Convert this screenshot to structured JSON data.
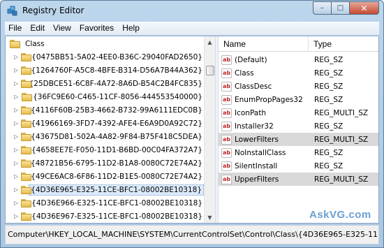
{
  "window": {
    "title": "Registry Editor"
  },
  "menu": [
    "File",
    "Edit",
    "View",
    "Favorites",
    "Help"
  ],
  "tree": {
    "root": "Class",
    "items": [
      "{0475BB51-5A02-4EE0-B36C-29040FAD2650}",
      "{1264760F-A5C8-4BFE-B314-D56A7B44A362}",
      "{25DBCE51-6C8F-4A72-8A6D-B54C2B4FC835}",
      "{36FC9E60-C465-11CF-8056-444553540000}",
      "{4116F60B-25B3-4662-B732-99A6111EDC0B}",
      "{41966169-3FD7-4392-AFE4-E6A9D0A92C72}",
      "{43675D81-502A-4A82-9F84-B75F418C5DEA}",
      "{4658EE7E-F050-11D1-B6BD-00C04FA372A7}",
      "{48721B56-6795-11D2-B1A8-0080C72E74A2}",
      "{49CE6AC8-6F86-11D2-B1E5-0080C72E74A2}",
      "{4D36E965-E325-11CE-BFC1-08002BE10318}",
      "{4D36E966-E325-11CE-BFC1-08002BE10318}",
      "{4D36E967-E325-11CE-BFC1-08002BE10318}"
    ],
    "selected_index": 10
  },
  "values_list": {
    "headers": {
      "name": "Name",
      "type": "Type"
    },
    "rows": [
      {
        "name": "(Default)",
        "type": "REG_SZ",
        "highlight": false
      },
      {
        "name": "Class",
        "type": "REG_SZ",
        "highlight": false
      },
      {
        "name": "ClassDesc",
        "type": "REG_SZ",
        "highlight": false
      },
      {
        "name": "EnumPropPages32",
        "type": "REG_SZ",
        "highlight": false
      },
      {
        "name": "IconPath",
        "type": "REG_MULTI_SZ",
        "highlight": false
      },
      {
        "name": "Installer32",
        "type": "REG_SZ",
        "highlight": false
      },
      {
        "name": "LowerFilters",
        "type": "REG_MULTI_SZ",
        "highlight": true
      },
      {
        "name": "NoInstallClass",
        "type": "REG_SZ",
        "highlight": false
      },
      {
        "name": "SilentInstall",
        "type": "REG_SZ",
        "highlight": false
      },
      {
        "name": "UpperFilters",
        "type": "REG_MULTI_SZ",
        "highlight": true
      }
    ]
  },
  "value_icon_text": "ab",
  "status": "Computer\\HKEY_LOCAL_MACHINE\\SYSTEM\\CurrentControlSet\\Control\\Class\\{4D36E965-E325-11",
  "watermark": "AskVG.com",
  "caption_buttons": {
    "minimize": "–",
    "maximize": "□",
    "close": "✕"
  },
  "colors": {
    "selection": "#dcebfb",
    "highlight_row": "#d9d9d9",
    "value_icon_red": "#c0282d",
    "folder": "#e6bd4c"
  }
}
